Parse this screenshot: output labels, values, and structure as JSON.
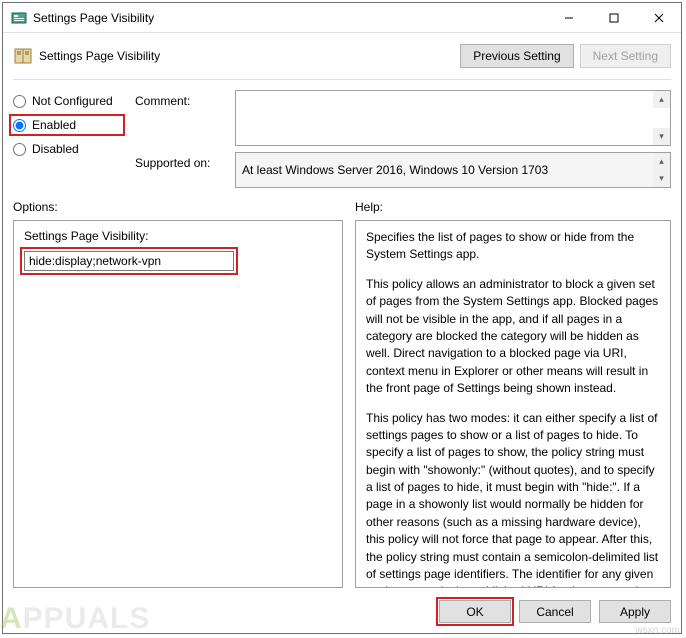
{
  "window": {
    "title": "Settings Page Visibility",
    "minimize": "–",
    "maximize": "☐",
    "close": "✕"
  },
  "header": {
    "title": "Settings Page Visibility",
    "prev": "Previous Setting",
    "next": "Next Setting"
  },
  "radios": {
    "not_configured": "Not Configured",
    "enabled": "Enabled",
    "disabled": "Disabled"
  },
  "labels": {
    "comment": "Comment:",
    "supported": "Supported on:",
    "options": "Options:",
    "help": "Help:",
    "setting_field": "Settings Page Visibility:"
  },
  "values": {
    "comment": "",
    "supported": "At least Windows Server 2016, Windows 10 Version 1703",
    "setting_field": "hide:display;network-vpn"
  },
  "help": {
    "p1": "Specifies the list of pages to show or hide from the System Settings app.",
    "p2": "This policy allows an administrator to block a given set of pages from the System Settings app. Blocked pages will not be visible in the app, and if all pages in a category are blocked the category will be hidden as well. Direct navigation to a blocked page via URI, context menu in Explorer or other means will result in the front page of Settings being shown instead.",
    "p3": "This policy has two modes: it can either specify a list of settings pages to show or a list of pages to hide. To specify a list of pages to show, the policy string must begin with \"showonly:\" (without quotes), and to specify a list of pages to hide, it must begin with \"hide:\". If a page in a showonly list would normally be hidden for other reasons (such as a missing hardware device), this policy will not force that page to appear. After this, the policy string must contain a semicolon-delimited list of settings page identifiers. The identifier for any given settings page is the published URI for that page, minus the \"ms-settings:\" protocol part."
  },
  "buttons": {
    "ok": "OK",
    "cancel": "Cancel",
    "apply": "Apply"
  },
  "watermark": {
    "brand_a": "A",
    "brand_rest": "PPUALS",
    "site": "wsxn.com"
  }
}
